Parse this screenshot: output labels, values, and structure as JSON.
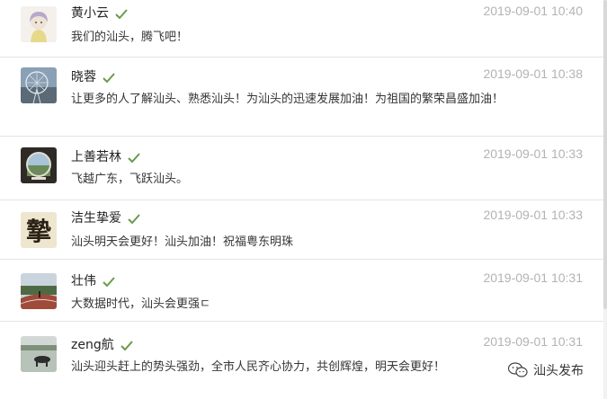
{
  "comments": [
    {
      "name": "黄小云",
      "time": "2019-09-01 10:40",
      "text": "我们的汕头，腾飞吧！",
      "avatar": "cartoon-girl-avatar"
    },
    {
      "name": "晓蓉",
      "time": "2019-09-01 10:38",
      "text": "让更多的人了解汕头、熟悉汕头！为汕头的迅速发展加油！为祖国的繁荣昌盛加油！",
      "avatar": "ferris-wheel-avatar"
    },
    {
      "name": "上善若林",
      "time": "2019-09-01 10:33",
      "text": "飞越广东，飞跃汕头。",
      "avatar": "round-window-avatar"
    },
    {
      "name": "洁生挚爱",
      "time": "2019-09-01 10:33",
      "text": "汕头明天会更好！汕头加油！祝福粤东明珠",
      "avatar": "calligraphy-avatar",
      "avatar_char": "摯"
    },
    {
      "name": "壮伟",
      "time": "2019-09-01 10:31",
      "text": "大数据时代，汕头会更强ㄷ",
      "avatar": "running-track-avatar"
    },
    {
      "name": "zeng航",
      "time": "2019-09-01 10:31",
      "text": "汕头迎头赶上的势头强劲，全市人民齐心协力，共创辉煌，明天会更好！",
      "avatar": "buffalo-field-avatar"
    }
  ],
  "watermark": {
    "text": "汕头发布",
    "icon": "wechat-icon"
  },
  "colors": {
    "check": "#6a9a4a",
    "time": "#b3b3b3",
    "divider": "#e4e4e4"
  }
}
